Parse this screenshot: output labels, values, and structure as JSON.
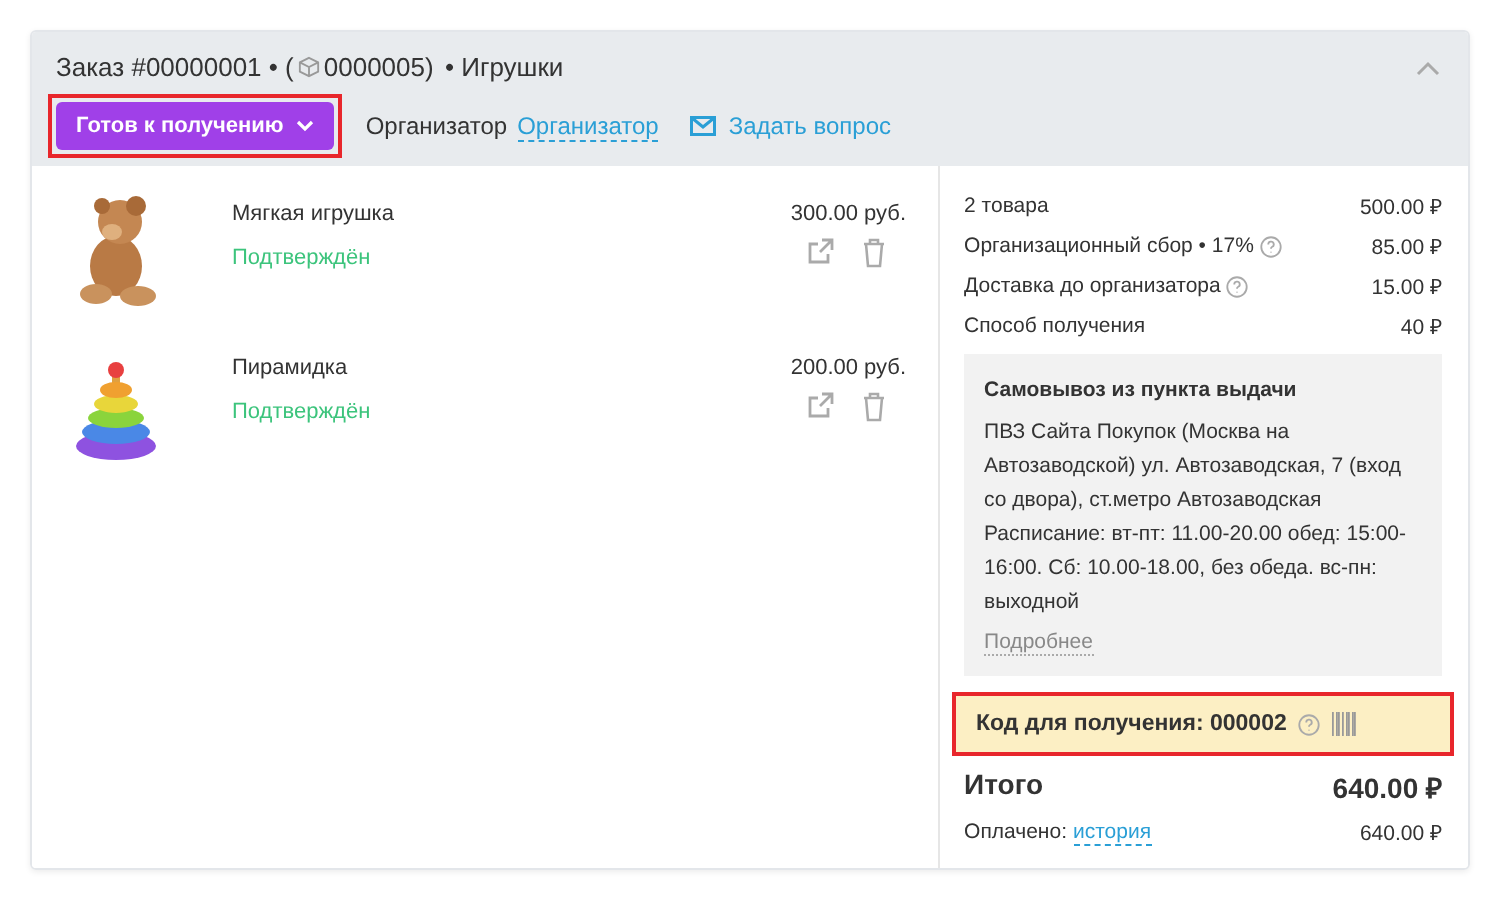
{
  "order": {
    "title_prefix": "Заказ #00000001 • (",
    "box_number": "0000005)",
    "title_suffix": "• Игрушки",
    "expanded": true
  },
  "status_button": {
    "label": "Готов к получению",
    "highlighted": true
  },
  "organizer": {
    "label": "Организатор",
    "link": "Организатор"
  },
  "ask_link": "Задать вопрос",
  "items": [
    {
      "name": "Мягкая игрушка",
      "status": "Подтверждён",
      "price": "300.00 руб."
    },
    {
      "name": "Пирамидка",
      "status": "Подтверждён",
      "price": "200.00 руб."
    }
  ],
  "summary": [
    {
      "label": "2 товара",
      "value": "500.00 ₽",
      "help": false
    },
    {
      "label": "Организационный сбор • 17%",
      "value": "85.00 ₽",
      "help": true
    },
    {
      "label": "Доставка до организатора",
      "value": "15.00 ₽",
      "help": true
    },
    {
      "label": "Способ получения",
      "value": "40 ₽",
      "help": false
    }
  ],
  "pickup": {
    "title": "Самовывоз из пункта выдачи",
    "address": "ПВЗ Сайта Покупок (Москва на Автозаводской) ул. Автозаводская, 7 (вход со двора), ст.метро Автозаводская",
    "schedule": "Расписание: вт-пт: 11.00-20.00 обед: 15:00-16:00. Сб: 10.00-18.00, без обеда. вс-пн: выходной",
    "more": "Подробнее"
  },
  "code": {
    "text": "Код для получения: 000002",
    "highlighted": true
  },
  "total": {
    "label": "Итого",
    "value": "640.00 ₽"
  },
  "paid": {
    "label": "Оплачено:",
    "link": "история",
    "value": "640.00 ₽"
  }
}
